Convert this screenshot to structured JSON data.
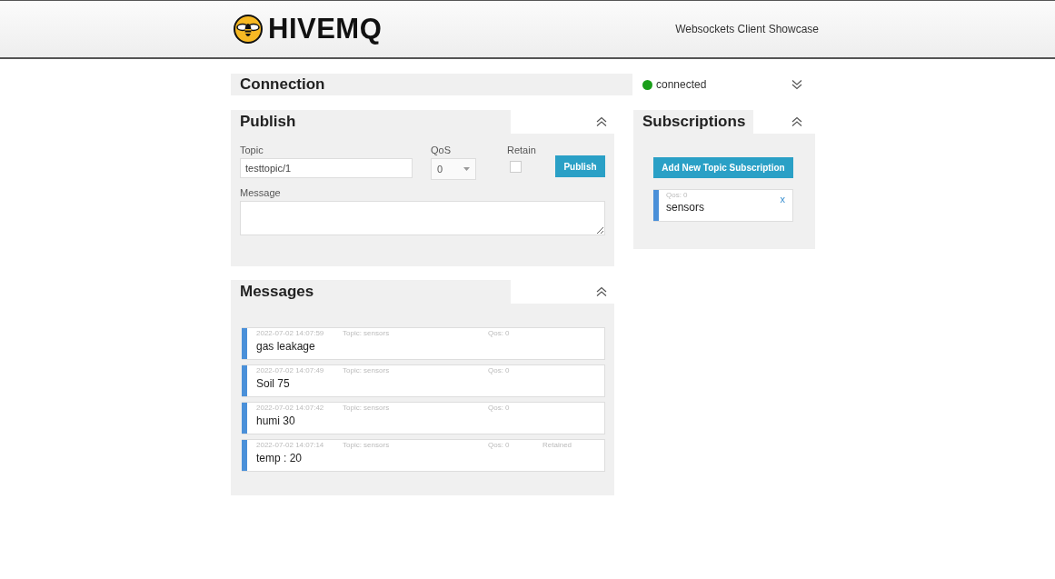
{
  "header": {
    "logo_text": "HIVEMQ",
    "subtitle": "Websockets Client Showcase"
  },
  "connection": {
    "title": "Connection",
    "status": "connected",
    "connected": true,
    "expanded": false
  },
  "publish": {
    "title": "Publish",
    "expanded": true,
    "topic_label": "Topic",
    "topic_value": "testtopic/1",
    "qos_label": "QoS",
    "qos_value": "0",
    "retain_label": "Retain",
    "retain_checked": false,
    "button": "Publish",
    "message_label": "Message"
  },
  "subscriptions": {
    "title": "Subscriptions",
    "expanded": true,
    "add_button": "Add New Topic Subscription",
    "items": [
      {
        "qos": "Qos: 0",
        "topic": "sensors",
        "remove": "x",
        "color": "#4a90d9"
      }
    ]
  },
  "messages": {
    "title": "Messages",
    "expanded": true,
    "items": [
      {
        "time": "2022-07-02 14:07:59",
        "topic": "Topic: sensors",
        "qos": "Qos: 0",
        "text": "gas leakage",
        "color": "#4a90d9"
      },
      {
        "time": "2022-07-02 14:07:49",
        "topic": "Topic: sensors",
        "qos": "Qos: 0",
        "text": "Soil 75",
        "color": "#4a90d9"
      },
      {
        "time": "2022-07-02 14:07:42",
        "topic": "Topic: sensors",
        "qos": "Qos: 0",
        "text": "humi 30",
        "color": "#4a90d9"
      },
      {
        "time": "2022-07-02 14:07:14",
        "topic": "Topic: sensors",
        "qos": "Qos: 0",
        "flag": "Retained",
        "text": "temp : 20",
        "color": "#4a90d9"
      }
    ]
  }
}
